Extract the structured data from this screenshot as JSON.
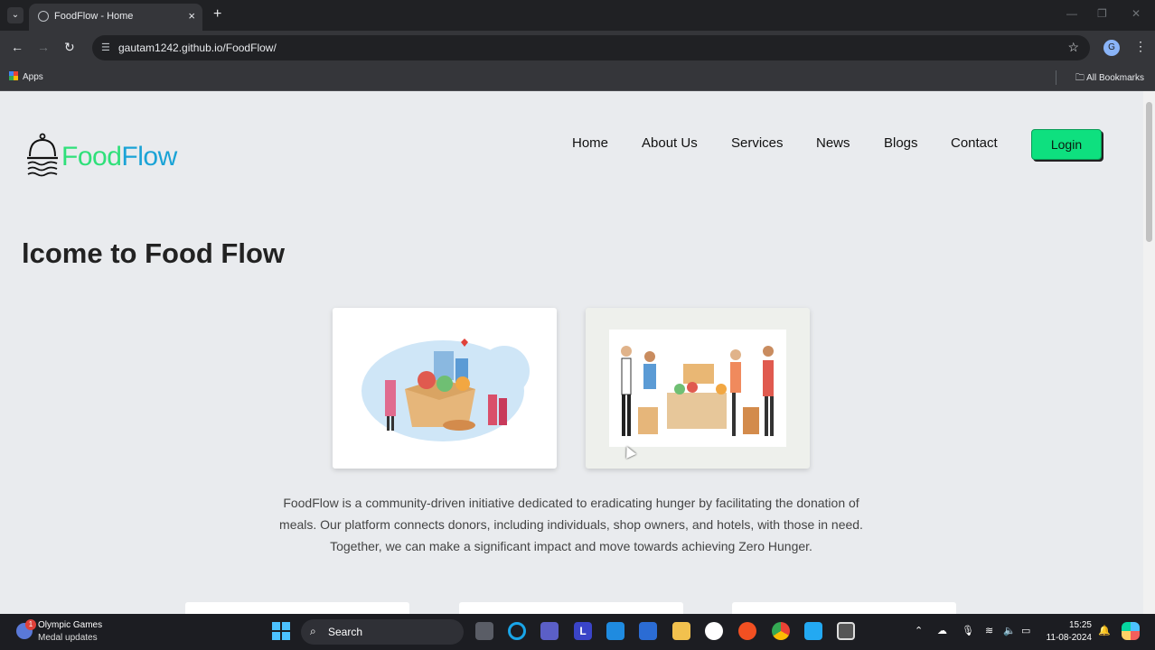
{
  "browser": {
    "tab_title": "FoodFlow - Home",
    "tab_close": "×",
    "new_tab": "+",
    "url": "gautam1242.github.io/FoodFlow/",
    "bookmarks_apps": "Apps",
    "all_bookmarks": "All Bookmarks",
    "profile_initial": "G"
  },
  "site": {
    "logo_food": "Food",
    "logo_flow": "Flow",
    "nav": [
      "Home",
      "About Us",
      "Services",
      "News",
      "Blogs",
      "Contact"
    ],
    "login": "Login",
    "welcome": "lcome to Food Flow",
    "description": "FoodFlow is a community-driven initiative dedicated to eradicating hunger by facilitating the donation of meals. Our platform connects donors, including individuals, shop owners, and hotels, with those in need. Together, we can make a significant impact and move towards achieving Zero Hunger."
  },
  "taskbar": {
    "news_title": "Olympic Games",
    "news_sub": "Medal updates",
    "news_badge": "1",
    "search_label": "Search",
    "time": "15:25",
    "date": "11-08-2024"
  }
}
